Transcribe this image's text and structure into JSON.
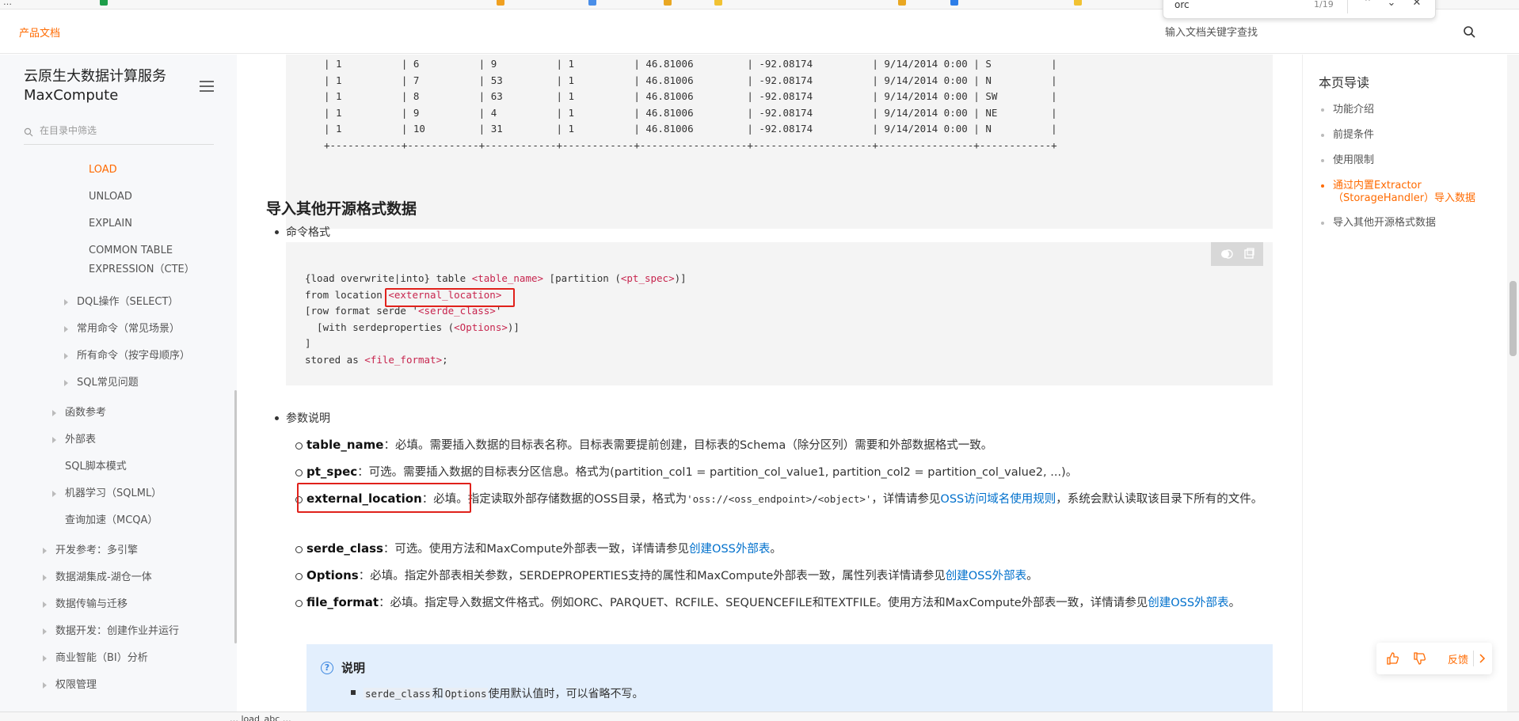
{
  "bookmarks": {
    "items": [
      "…",
      "",
      "",
      "",
      "",
      "",
      ""
    ]
  },
  "findbar": {
    "query": "orc",
    "count": "1/19"
  },
  "header": {
    "brand": "产品文档",
    "search_placeholder": "输入文档关键字查找"
  },
  "sidebar": {
    "title": "云原生大数据计算服务 MaxCompute",
    "filter_placeholder": "在目录中筛选",
    "items": [
      {
        "label": "LOAD",
        "active": true
      },
      {
        "label": "UNLOAD"
      },
      {
        "label": "EXPLAIN"
      },
      {
        "label": "COMMON TABLE"
      },
      {
        "label": "EXPRESSION（CTE）"
      },
      {
        "label": "DQL操作（SELECT）"
      },
      {
        "label": "常用命令（常见场景）"
      },
      {
        "label": "所有命令（按字母顺序）"
      },
      {
        "label": "SQL常见问题"
      },
      {
        "label": "函数参考"
      },
      {
        "label": "外部表"
      },
      {
        "label": "SQL脚本模式"
      },
      {
        "label": "机器学习（SQLML）"
      },
      {
        "label": "查询加速（MCQA）"
      },
      {
        "label": "开发参考：多引擎"
      },
      {
        "label": "数据湖集成-湖仓一体"
      },
      {
        "label": "数据传输与迁移"
      },
      {
        "label": "数据开发：创建作业并运行"
      },
      {
        "label": "商业智能（BI）分析"
      },
      {
        "label": "权限管理"
      }
    ]
  },
  "content": {
    "top_table_lines": [
      "| 1          | 6          | 9          | 1          | 46.81006         | -92.08174          | 9/14/2014 0:00 | S          |",
      "| 1          | 7          | 53         | 1          | 46.81006         | -92.08174          | 9/14/2014 0:00 | N          |",
      "| 1          | 8          | 63         | 1          | 46.81006         | -92.08174          | 9/14/2014 0:00 | SW         |",
      "| 1          | 9          | 4          | 1          | 46.81006         | -92.08174          | 9/14/2014 0:00 | NE         |",
      "| 1          | 10         | 31         | 1          | 46.81006         | -92.08174          | 9/14/2014 0:00 | N          |",
      "+------------+------------+------------+------------+------------------+--------------------+----------------+------------+"
    ],
    "heading": "导入其他开源格式数据",
    "cmd_format_label": "命令格式",
    "code": {
      "line1_a": "{load overwrite|into} table ",
      "line1_t1": "<table_name>",
      "line1_b": " [partition (",
      "line1_t2": "<pt_spec>",
      "line1_c": ")]",
      "line2_a": "from location ",
      "line2_t": "<external_location>",
      "line3_a": "[row format serde '",
      "line3_t": "<serde_class>",
      "line3_b": "'",
      "line4_a": "  [with serdeproperties (",
      "line4_t": "<Options>",
      "line4_b": ")]",
      "line5": "]",
      "line6_a": "stored as ",
      "line6_t": "<file_format>",
      "line6_b": ";"
    },
    "params_label": "参数说明",
    "params": [
      {
        "name": "table_name",
        "text": "：必填。需要插入数据的目标表名称。目标表需要提前创建，目标表的Schema（除分区列）需要和外部数据格式一致。"
      },
      {
        "name": "pt_spec",
        "text": "：可选。需要插入数据的目标表分区信息。格式为(partition_col1 = partition_col_value1, partition_col2 = partition_col_value2, ...)。"
      },
      {
        "name": "external_location",
        "text_a": "：必填。指定读取外部存储数据的OSS目录，格式为",
        "code": "'oss://<oss_endpoint>/<object>'",
        "text_b": "，详情请参见",
        "link": "OSS访问域名使用规则",
        "text_c": "，系统会默认读取该目录下所有的文件。"
      },
      {
        "name": "serde_class",
        "text_a": "：可选。使用方法和MaxCompute外部表一致，详情请参见",
        "link": "创建OSS外部表",
        "text_b": "。"
      },
      {
        "name": "Options",
        "text_a": "：必填。指定外部表相关参数，SERDEPROPERTIES支持的属性和MaxCompute外部表一致，属性列表详情请参见",
        "link": "创建OSS外部表",
        "text_b": "。"
      },
      {
        "name": "file_format",
        "text_a": "：必填。指定导入数据文件格式。例如ORC、PARQUET、RCFILE、SEQUENCEFILE和TEXTFILE。使用方法和MaxCompute外部表一致，详情请参见",
        "link": "创建OSS外部表",
        "text_b": "。"
      }
    ],
    "note": {
      "title": "说明",
      "code1": "serde_class",
      "mid": "和",
      "code2": "Options",
      "tail": "使用默认值时，可以省略不写。"
    }
  },
  "toc": {
    "title": "本页导读",
    "items": [
      {
        "label": "功能介绍"
      },
      {
        "label": "前提条件"
      },
      {
        "label": "使用限制"
      },
      {
        "label": "通过内置Extractor（StorageHandler）导入数据",
        "active": true
      },
      {
        "label": "导入其他开源格式数据"
      }
    ]
  },
  "feedback": {
    "label": "反馈"
  },
  "bottom": {
    "text": "… load_abc … "
  },
  "colors": {
    "accent": "#ff6a00",
    "link": "#0070cc",
    "highlight_box": "#e0211b"
  }
}
